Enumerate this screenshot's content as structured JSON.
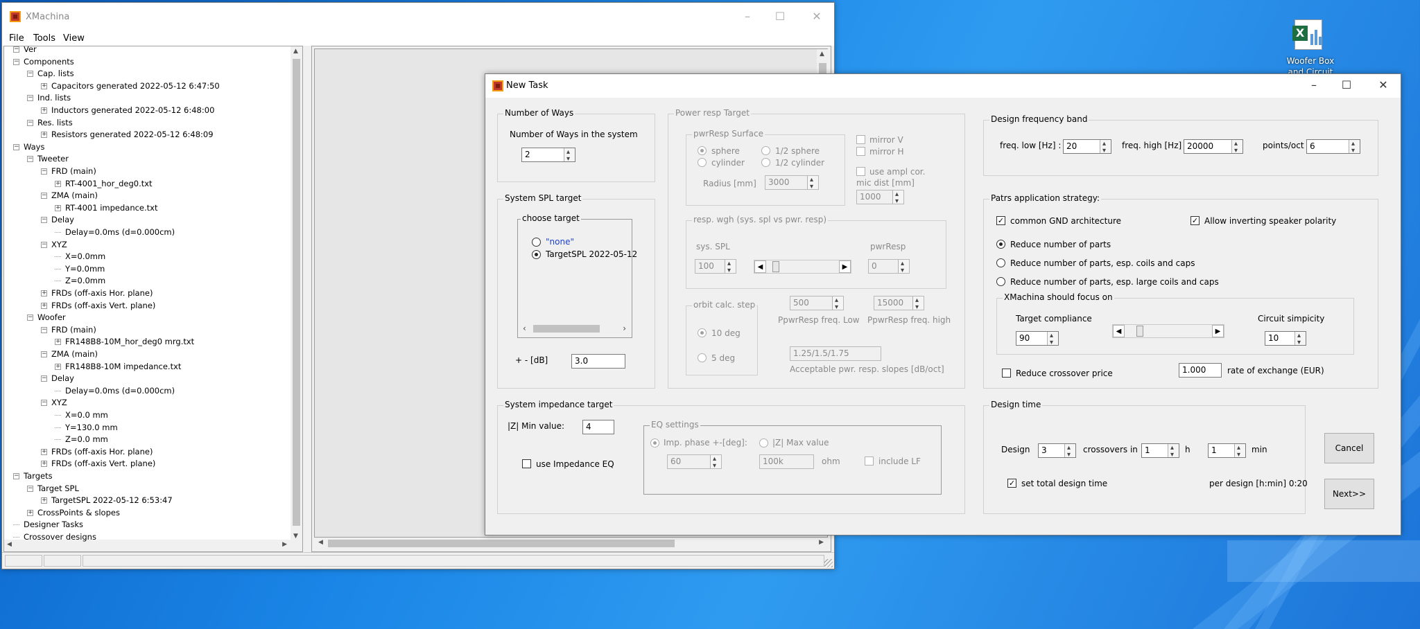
{
  "desktop": {
    "icon_label": "Woofer Box and Circuit"
  },
  "main_window": {
    "title": "XMachina",
    "menu": [
      "File",
      "Tools",
      "View"
    ],
    "tree": [
      {
        "label": "Ver",
        "level": 0
      },
      {
        "label": "Components",
        "level": 0
      },
      {
        "label": "Cap. lists",
        "level": 1
      },
      {
        "label": "Capacitors generated 2022-05-12 6:47:50",
        "level": 2
      },
      {
        "label": "Ind. lists",
        "level": 1
      },
      {
        "label": "Inductors generated 2022-05-12 6:48:00",
        "level": 2
      },
      {
        "label": "Res. lists",
        "level": 1
      },
      {
        "label": "Resistors generated 2022-05-12 6:48:09",
        "level": 2
      },
      {
        "label": "Ways",
        "level": 0
      },
      {
        "label": "Tweeter",
        "level": 1
      },
      {
        "label": "FRD (main)",
        "level": 2
      },
      {
        "label": "RT-4001_hor_deg0.txt",
        "level": 3
      },
      {
        "label": "ZMA (main)",
        "level": 2
      },
      {
        "label": "RT-4001 impedance.txt",
        "level": 3
      },
      {
        "label": "Delay",
        "level": 2
      },
      {
        "label": "Delay=0.0ms (d=0.000cm)",
        "level": 3
      },
      {
        "label": "XYZ",
        "level": 2
      },
      {
        "label": "X=0.0mm",
        "level": 3
      },
      {
        "label": "Y=0.0mm",
        "level": 3
      },
      {
        "label": "Z=0.0mm",
        "level": 3
      },
      {
        "label": "FRDs (off-axis Hor. plane)",
        "level": 2
      },
      {
        "label": "FRDs (off-axis Vert. plane)",
        "level": 2
      },
      {
        "label": "Woofer",
        "level": 1
      },
      {
        "label": "FRD (main)",
        "level": 2
      },
      {
        "label": "FR148B8-10M_hor_deg0 mrg.txt",
        "level": 3
      },
      {
        "label": "ZMA (main)",
        "level": 2
      },
      {
        "label": "FR148B8-10M impedance.txt",
        "level": 3
      },
      {
        "label": "Delay",
        "level": 2
      },
      {
        "label": "Delay=0.0ms (d=0.000cm)",
        "level": 3
      },
      {
        "label": "XYZ",
        "level": 2
      },
      {
        "label": "X=0.0 mm",
        "level": 3
      },
      {
        "label": "Y=130.0 mm",
        "level": 3
      },
      {
        "label": "Z=0.0 mm",
        "level": 3
      },
      {
        "label": "FRDs (off-axis Hor. plane)",
        "level": 2
      },
      {
        "label": "FRDs (off-axis Vert. plane)",
        "level": 2
      },
      {
        "label": "Targets",
        "level": 0
      },
      {
        "label": "Target SPL",
        "level": 1
      },
      {
        "label": "TargetSPL 2022-05-12 6:53:47",
        "level": 2
      },
      {
        "label": "CrossPoints & slopes",
        "level": 1
      },
      {
        "label": "Designer Tasks",
        "level": 0
      },
      {
        "label": "Crossover designs",
        "level": 0
      }
    ]
  },
  "dialog": {
    "title": "New Task",
    "ways": {
      "group": "Number of Ways",
      "label": "Number of Ways in the system",
      "value": "2"
    },
    "spl_target": {
      "group": "System SPL target",
      "choose_group": "choose target",
      "options": [
        "\"none\"",
        "TargetSPL 2022-05-12"
      ],
      "tol_label": "+ - [dB]",
      "tol_value": "3.0"
    },
    "power": {
      "group": "Power resp Target",
      "surface_group": "pwrResp Surface",
      "sphere": "sphere",
      "half_sphere": "1/2 sphere",
      "cylinder": "cylinder",
      "half_cylinder": "1/2 cylinder",
      "radius_label": "Radius [mm]",
      "radius_value": "3000",
      "mirror_v": "mirror V",
      "mirror_h": "mirror H",
      "ampl_cor": "use ampl cor.",
      "mic_dist_label": "mic dist [mm]",
      "mic_dist_value": "1000",
      "wgh_group": "resp. wgh  (sys. spl vs pwr. resp)",
      "sys_spl_label": "sys. SPL",
      "pwr_label": "pwrResp",
      "sys_spl_value": "100",
      "pwr_value": "0",
      "orbit_group": "orbit calc. step",
      "deg10": "10 deg",
      "deg5": "5 deg",
      "freq_low_value": "500",
      "freq_high_value": "15000",
      "freq_low_label": "PpwrResp  freq. Low",
      "freq_high_label": "PpwrResp  freq. high",
      "slopes_value": "1.25/1.5/1.75",
      "slopes_label": "Acceptable pwr. resp. slopes [dB/oct]"
    },
    "freq_band": {
      "group": "Design frequency band",
      "low_label": "freq. low [Hz] :",
      "low_value": "20",
      "high_label": "freq. high [Hz] :",
      "high_value": "20000",
      "ppo_label": "points/oct",
      "ppo_value": "6"
    },
    "parts": {
      "group": "Patrs application strategy:",
      "common_gnd": "common GND architecture",
      "allow_invert": "Allow inverting speaker polarity",
      "reduce1": "Reduce number of parts",
      "reduce2": "Reduce number of parts, esp. coils and caps",
      "reduce3": "Reduce number of parts, esp. large coils and caps",
      "focus_group": "XMachina should focus on",
      "target_compliance": "Target compliance",
      "circuit_simplicity": "Circuit simpicity",
      "compliance_value": "90",
      "simplicity_value": "10",
      "reduce_price": "Reduce crossover price",
      "exchange_value": "1.000",
      "exchange_label": "rate of exchange (EUR)"
    },
    "impedance": {
      "group": "System impedance target",
      "min_label": "|Z| Min value:",
      "min_value": "4",
      "use_eq": "use Impedance EQ",
      "eq_group": "EQ settings",
      "imp_phase": "Imp. phase +-[deg]:",
      "z_max": "|Z| Max value",
      "phase_value": "60",
      "zmax_value": "100k",
      "ohm": "ohm",
      "include_lf": "include LF"
    },
    "design_time": {
      "group": "Design time",
      "design_label": "Design",
      "design_value": "3",
      "crossovers_in": "crossovers in",
      "hours_value": "1",
      "h": "h",
      "min_value": "1",
      "min": "min",
      "set_total": "set total design time",
      "per_design": "per design [h:min] 0:20"
    },
    "cancel": "Cancel",
    "next": "Next>>"
  }
}
